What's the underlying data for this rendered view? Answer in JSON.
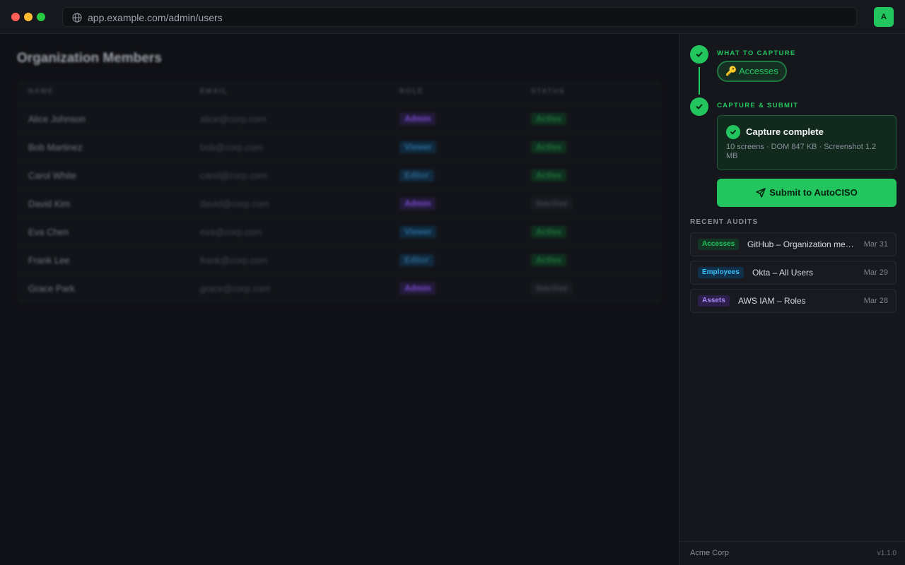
{
  "browser": {
    "url": "app.example.com/admin/users",
    "avatar_letter": "A",
    "icons": {
      "url_icon": "globe-icon"
    }
  },
  "main": {
    "title": "Organization Members",
    "columns": [
      "NAME",
      "EMAIL",
      "ROLE",
      "STATUS"
    ],
    "rows": [
      {
        "name": "Alice Johnson",
        "email": "alice@corp.com",
        "role": "Admin",
        "status": "Active"
      },
      {
        "name": "Bob Martinez",
        "email": "bob@corp.com",
        "role": "Viewer",
        "status": "Active"
      },
      {
        "name": "Carol White",
        "email": "carol@corp.com",
        "role": "Editor",
        "status": "Active"
      },
      {
        "name": "David Kim",
        "email": "david@corp.com",
        "role": "Admin",
        "status": "Inactive"
      },
      {
        "name": "Eva Chen",
        "email": "eva@corp.com",
        "role": "Viewer",
        "status": "Active"
      },
      {
        "name": "Frank Lee",
        "email": "frank@corp.com",
        "role": "Editor",
        "status": "Active"
      },
      {
        "name": "Grace Park",
        "email": "grace@corp.com",
        "role": "Admin",
        "status": "Inactive"
      }
    ]
  },
  "panel": {
    "step1": {
      "label": "WHAT TO CAPTURE",
      "chip": "🔑 Accesses"
    },
    "step2": {
      "label": "CAPTURE & SUBMIT"
    },
    "capture": {
      "title": "Capture complete",
      "meta": "10 screens · DOM 847 KB · Screenshot 1.2 MB"
    },
    "submit_label": "Submit to AutoCISO",
    "recent_label": "RECENT AUDITS",
    "audits": [
      {
        "tag": "Accesses",
        "title": "GitHub – Organization members",
        "date": "Mar 31"
      },
      {
        "tag": "Employees",
        "title": "Okta – All Users",
        "date": "Mar 29"
      },
      {
        "tag": "Assets",
        "title": "AWS IAM – Roles",
        "date": "Mar 28"
      }
    ],
    "footer": {
      "org": "Acme Corp",
      "version": "v1.1.0"
    }
  },
  "colors": {
    "accent": "#22c55e",
    "background": "#0f1014",
    "panel": "#16171c"
  }
}
